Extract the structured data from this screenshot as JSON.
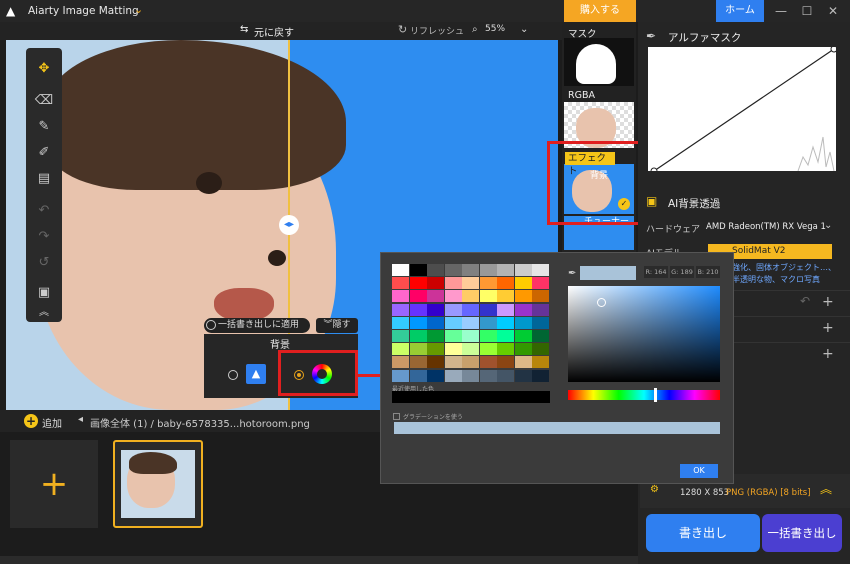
{
  "app": {
    "title": "Aiarty Image Matting",
    "buy_label": "購入する",
    "home_label": "ホーム"
  },
  "window": {
    "minimize": "—",
    "maximize": "☐",
    "close": "✕"
  },
  "topbar": {
    "undo_label": "元に戻す",
    "refresh_label": "リフレッシュ",
    "zoom": "55%"
  },
  "canvas": {
    "apply_all_label": "一括書き出しに適用",
    "hide_label": "隠す",
    "background_title": "背景"
  },
  "file_bar": {
    "add_label": "追加",
    "breadcrumb": "画像全体 (1)  /  baby-6578335...hotoroom.png"
  },
  "preview": {
    "mask_label": "マスク",
    "rgba_label": "RGBA",
    "effect_label": "エフェクト",
    "background_label": "背景",
    "tune_label": "チューナー"
  },
  "right": {
    "alpha_mask_title": "アルファマスク",
    "ai_title": "AI背景透過",
    "hardware_label": "ハードウェア",
    "hardware_value": "AMD Radeon(TM) RX Vega 1",
    "model_label": "AIモデル",
    "model_value": "SolidMat  V2",
    "model_desc": "強化、固体オブジェクト…、半透明な物、マクロ写真",
    "resolution": "1280 X 853",
    "format": "PNG (RGBA) [8 bits]",
    "export_label": "書き出し",
    "bulk_export_label": "一括書き出し"
  },
  "color_dialog": {
    "recent_label": "最近使用した色",
    "r": "R: 164",
    "g": "G: 189",
    "b": "B: 210",
    "gradient_label": "グラデーションを使う",
    "ok_label": "OK",
    "current_color": "#a9c3d9"
  },
  "colors": {
    "accent_orange": "#f5a623",
    "accent_blue": "#2f7ff0",
    "highlight_red": "#e01f1f"
  }
}
